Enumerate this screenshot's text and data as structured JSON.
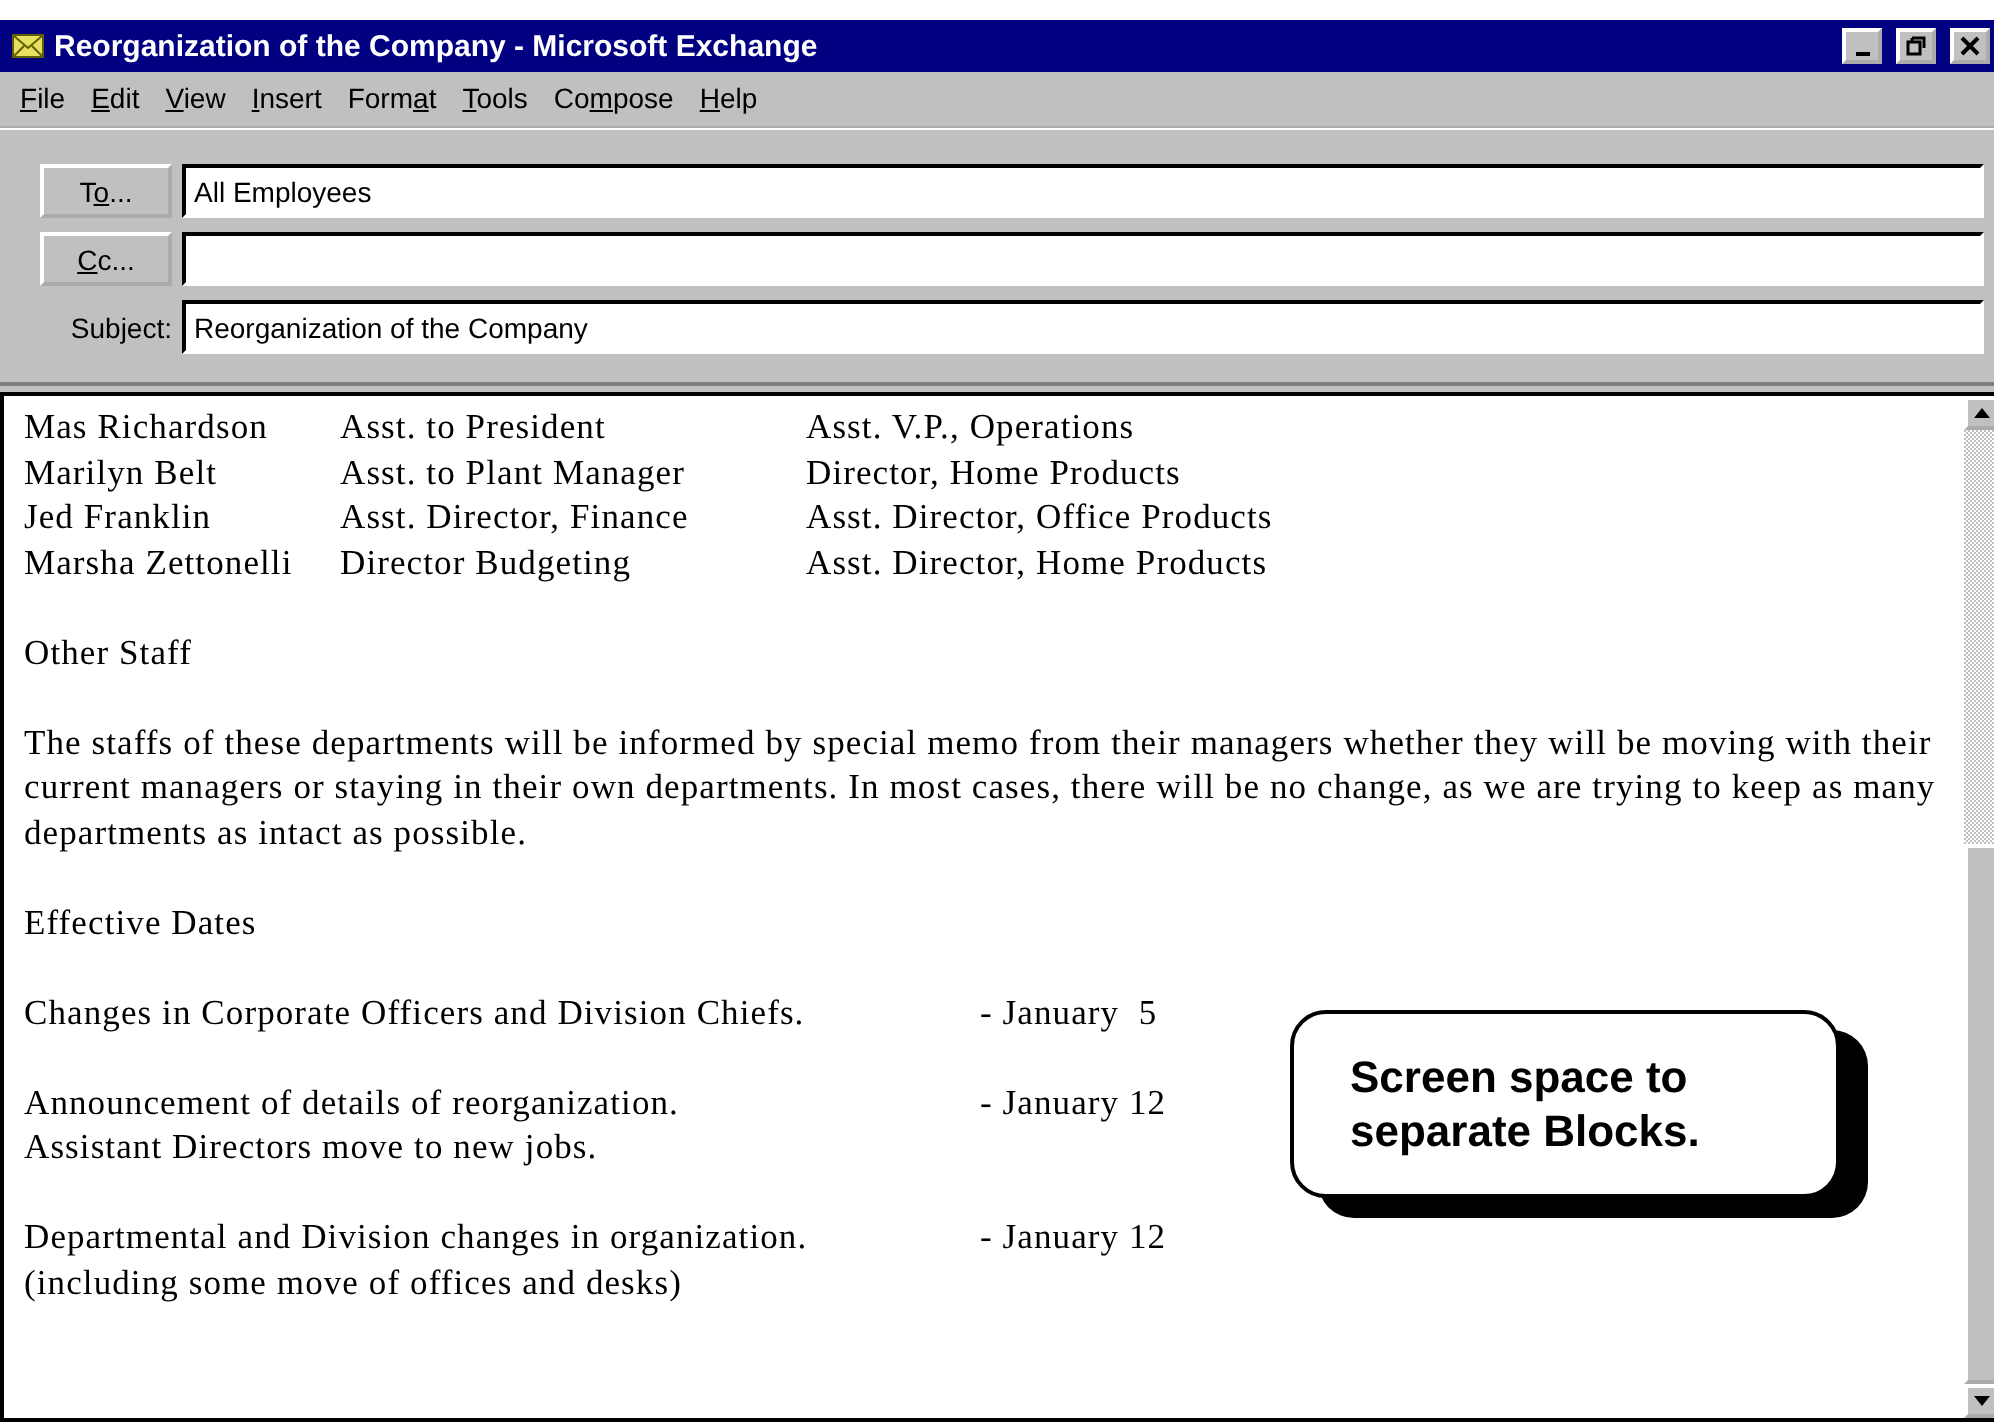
{
  "window": {
    "title": "Reorganization of the Company - Microsoft Exchange"
  },
  "menu": [
    {
      "key": "F",
      "after": "ile"
    },
    {
      "key": "E",
      "after": "dit"
    },
    {
      "key": "V",
      "after": "iew"
    },
    {
      "key": "I",
      "after": "nsert"
    },
    {
      "before": "Form",
      "key": "a",
      "after": "t"
    },
    {
      "key": "T",
      "after": "ools"
    },
    {
      "before": "Co",
      "key": "m",
      "after": "pose"
    },
    {
      "key": "H",
      "after": "elp"
    }
  ],
  "header_fields": [
    {
      "kind": "button",
      "before": "T",
      "key": "o",
      "after": "...",
      "value": "All Employees"
    },
    {
      "kind": "button",
      "key": "C",
      "after": "c..."
    },
    {
      "kind": "label",
      "after": "Subject:",
      "value": "Reorganization of the Company"
    }
  ],
  "staff_table": [
    [
      "Mas Richardson",
      "Asst. to President",
      "Asst. V.P., Operations"
    ],
    [
      "Marilyn Belt",
      "Asst. to Plant Manager",
      "Director, Home Products"
    ],
    [
      "Jed Franklin",
      "Asst. Director, Finance",
      "Asst. Director, Office Products"
    ],
    [
      "Marsha Zettonelli",
      "Director Budgeting",
      "Asst. Director, Home Products"
    ]
  ],
  "other_staff_heading": "Other Staff",
  "other_staff_text": "The staffs of these departments will be informed by special memo from their managers whether they will be moving with their current managers or staying in their own departments.  In most cases, there will be no change, as we are trying to keep as many departments as intact as possible.",
  "dates_heading": "Effective Dates",
  "dates": [
    {
      "lines": [
        "Changes in Corporate Officers and Division Chiefs."
      ],
      "date": "- January  5"
    },
    {
      "lines": [
        "Announcement of details of reorganization.",
        "Assistant Directors move to new jobs."
      ],
      "date": "- January 12"
    },
    {
      "lines": [
        "Departmental and Division changes in organization.",
        "(including some move of offices and desks)"
      ],
      "date": "- January 12"
    }
  ],
  "callout": "Screen space to separate Blocks."
}
